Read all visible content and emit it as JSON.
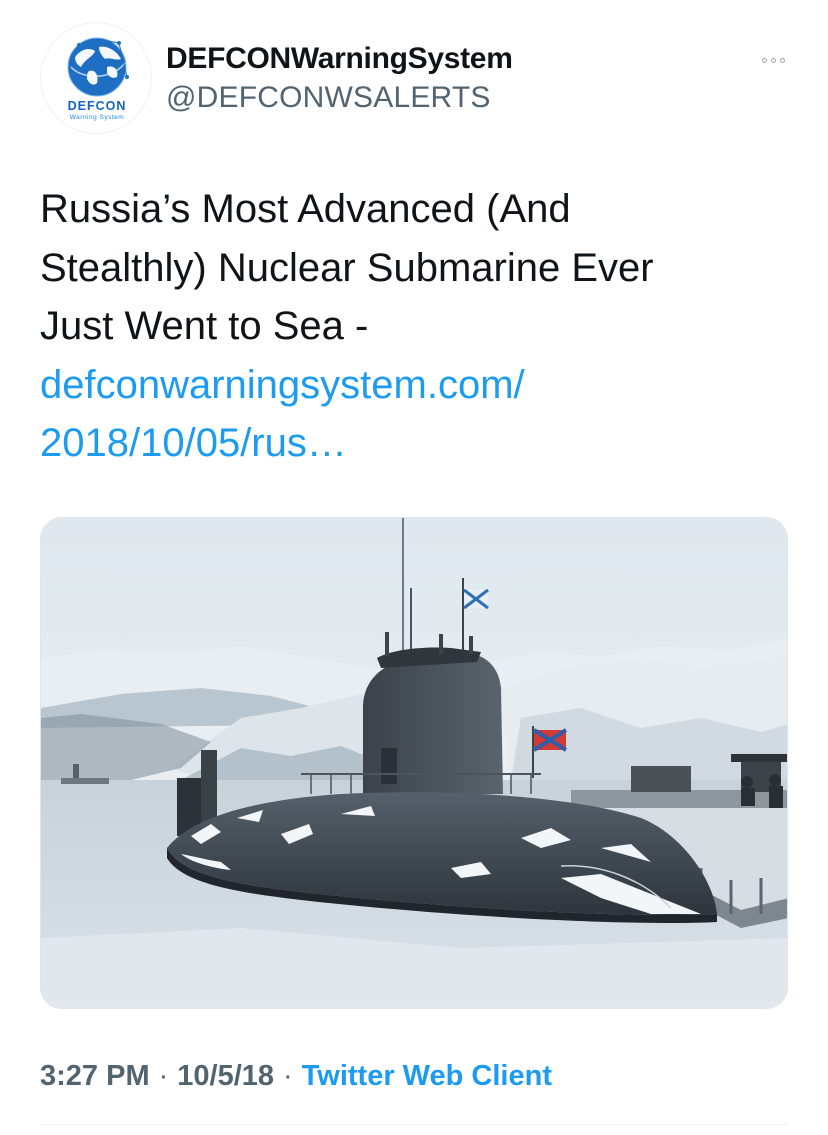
{
  "user": {
    "display_name": "DEFCONWarningSystem",
    "handle": "@DEFCONWSALERTS",
    "avatar_logo_text": "DEFCON",
    "avatar_logo_subtext": "Warning System"
  },
  "tweet": {
    "text_lines": [
      "Russia’s Most Advanced (And",
      "Stealthly) Nuclear Submarine Ever",
      "Just Went to Sea -"
    ],
    "link_lines": [
      "defconwarningsystem.com/",
      "2018/10/05/rus…"
    ],
    "media_icon": "photo-submarine"
  },
  "meta": {
    "time": "3:27 PM",
    "separator": "·",
    "date": "10/5/18",
    "source": "Twitter Web Client"
  },
  "icons": {
    "more": "more-horizontal-icon"
  },
  "colors": {
    "link": "#1d9bf0",
    "text": "#0f1419",
    "secondary": "#536471",
    "logo_blue": "#1565c0"
  }
}
